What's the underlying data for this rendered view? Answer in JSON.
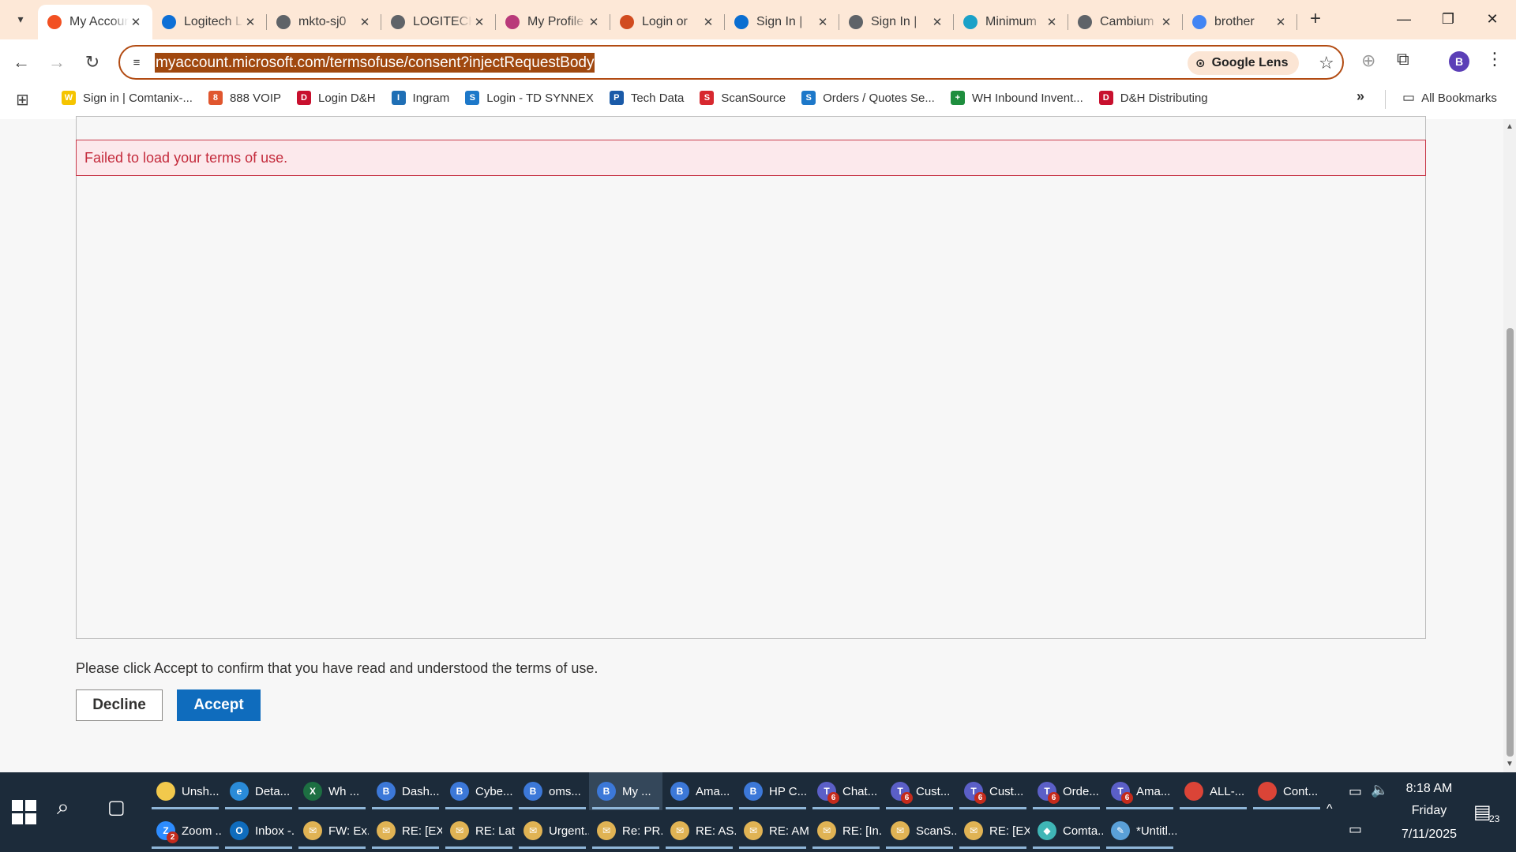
{
  "browser": {
    "tabs": [
      {
        "title": "My Account",
        "close": "✕",
        "icon_color": "#f25022",
        "active": true
      },
      {
        "title": "Logitech Login",
        "close": "✕",
        "icon_color": "#0d6fd6"
      },
      {
        "title": "mkto-sj0",
        "close": "✕",
        "icon_color": "#5f6368"
      },
      {
        "title": "LOGITECH",
        "close": "✕",
        "icon_color": "#5f6368"
      },
      {
        "title": "My Profile",
        "close": "✕",
        "icon_color": "#b93a7a"
      },
      {
        "title": "Login or",
        "close": "✕",
        "icon_color": "#d14b1f"
      },
      {
        "title": "Sign In |",
        "close": "✕",
        "icon_color": "#0a6ed1"
      },
      {
        "title": "Sign In |",
        "close": "✕",
        "icon_color": "#5f6368"
      },
      {
        "title": "Minimum",
        "close": "✕",
        "icon_color": "#1aa1c8"
      },
      {
        "title": "Cambium",
        "close": "✕",
        "icon_color": "#5f6368"
      },
      {
        "title": "brother",
        "close": "✕",
        "icon_color": "#4285f4"
      }
    ],
    "new_tab": "+",
    "window": {
      "minimize": "—",
      "restore": "❐",
      "close": "✕"
    },
    "nav": {
      "back": "←",
      "forward": "→",
      "reload": "↻"
    },
    "url": "myaccount.microsoft.com/termsofuse/consent?injectRequestBody",
    "lens_label": "Google Lens",
    "profile_initial": "B",
    "icons": {
      "site_info": "≡",
      "lens": "⊙",
      "star": "☆",
      "translate": "⊕",
      "extensions": "⧉",
      "menu": "⋮",
      "apps": "⊞",
      "more_bookmarks": "»",
      "folder": "▭"
    },
    "bookmarks": [
      {
        "label": "Sign in | Comtanix-...",
        "icon_color": "#f5c400",
        "glyph": "W"
      },
      {
        "label": "888 VOIP",
        "icon_color": "#e0562e",
        "glyph": "8"
      },
      {
        "label": "Login D&H",
        "icon_color": "#c8102e",
        "glyph": "D"
      },
      {
        "label": "Ingram",
        "icon_color": "#1f6fb5",
        "glyph": "I"
      },
      {
        "label": "Login - TD SYNNEX",
        "icon_color": "#1d78c9",
        "glyph": "S"
      },
      {
        "label": "Tech Data",
        "icon_color": "#1a5aa8",
        "glyph": "P"
      },
      {
        "label": "ScanSource",
        "icon_color": "#d7282f",
        "glyph": "S"
      },
      {
        "label": "Orders / Quotes Se...",
        "icon_color": "#1d78c9",
        "glyph": "S"
      },
      {
        "label": "WH Inbound Invent...",
        "icon_color": "#1e8e3e",
        "glyph": "+"
      },
      {
        "label": "D&H Distributing",
        "icon_color": "#c8102e",
        "glyph": "D"
      }
    ],
    "all_bookmarks": "All Bookmarks"
  },
  "page": {
    "error_message": "Failed to load your terms of use.",
    "confirm_text": "Please click Accept to confirm that you have read and understood the terms of use.",
    "decline_label": "Decline",
    "accept_label": "Accept",
    "scroll_up": "▲",
    "scroll_down": "▼"
  },
  "taskbar": {
    "search_icon": "⌕",
    "taskview_icon": "▢",
    "row1": [
      {
        "label": "Unsh...",
        "icon_color": "#f2c94c",
        "glyph": ""
      },
      {
        "label": "Deta...",
        "icon_color": "#2a8bd8",
        "glyph": "e"
      },
      {
        "label": "Wh ...",
        "icon_color": "#1d6f42",
        "glyph": "X"
      },
      {
        "label": "Dash...",
        "icon_color": "#3c78d8",
        "glyph": "B"
      },
      {
        "label": "Cybe...",
        "icon_color": "#3c78d8",
        "glyph": "B"
      },
      {
        "label": "oms...",
        "icon_color": "#3c78d8",
        "glyph": "B"
      },
      {
        "label": "My ...",
        "icon_color": "#3c78d8",
        "glyph": "B",
        "active": true
      },
      {
        "label": "Ama...",
        "icon_color": "#3c78d8",
        "glyph": "B"
      },
      {
        "label": "HP C...",
        "icon_color": "#3c78d8",
        "glyph": "B"
      },
      {
        "label": "Chat...",
        "icon_color": "#5b5fc7",
        "glyph": "T",
        "badge": "6"
      },
      {
        "label": "Cust...",
        "icon_color": "#5b5fc7",
        "glyph": "T",
        "badge": "6"
      },
      {
        "label": "Cust...",
        "icon_color": "#5b5fc7",
        "glyph": "T",
        "badge": "6"
      },
      {
        "label": "Orde...",
        "icon_color": "#5b5fc7",
        "glyph": "T",
        "badge": "6"
      },
      {
        "label": "Ama...",
        "icon_color": "#5b5fc7",
        "glyph": "T",
        "badge": "6"
      },
      {
        "label": "ALL-...",
        "icon_color": "#db4437",
        "glyph": ""
      },
      {
        "label": "Cont...",
        "icon_color": "#db4437",
        "glyph": ""
      }
    ],
    "row2": [
      {
        "label": "Zoom ...",
        "icon_color": "#2d8cff",
        "glyph": "Z",
        "badge": "2"
      },
      {
        "label": "Inbox -...",
        "icon_color": "#0f6cbd",
        "glyph": "O"
      },
      {
        "label": "FW: Ex...",
        "icon_color": "#e0b354",
        "glyph": "✉"
      },
      {
        "label": "RE: [EX...",
        "icon_color": "#e0b354",
        "glyph": "✉"
      },
      {
        "label": "RE: Lat...",
        "icon_color": "#e0b354",
        "glyph": "✉"
      },
      {
        "label": "Urgent...",
        "icon_color": "#e0b354",
        "glyph": "✉"
      },
      {
        "label": "Re: PR...",
        "icon_color": "#e0b354",
        "glyph": "✉"
      },
      {
        "label": "RE: AS...",
        "icon_color": "#e0b354",
        "glyph": "✉"
      },
      {
        "label": "RE: AM...",
        "icon_color": "#e0b354",
        "glyph": "✉"
      },
      {
        "label": "RE: [In...",
        "icon_color": "#e0b354",
        "glyph": "✉"
      },
      {
        "label": "ScanS...",
        "icon_color": "#e0b354",
        "glyph": "✉"
      },
      {
        "label": "RE: [EX...",
        "icon_color": "#e0b354",
        "glyph": "✉"
      },
      {
        "label": "Comta...",
        "icon_color": "#3fb6b6",
        "glyph": "◆"
      },
      {
        "label": "*Untitl...",
        "icon_color": "#5aa0d8",
        "glyph": "✎"
      }
    ],
    "tray": {
      "chevron": "^",
      "battery": "▭",
      "volume": "🔈",
      "network": "▭"
    },
    "clock": {
      "time": "8:18 AM",
      "day": "Friday",
      "date": "7/11/2025"
    },
    "notifications_icon": "▤",
    "notifications_count": "23"
  }
}
